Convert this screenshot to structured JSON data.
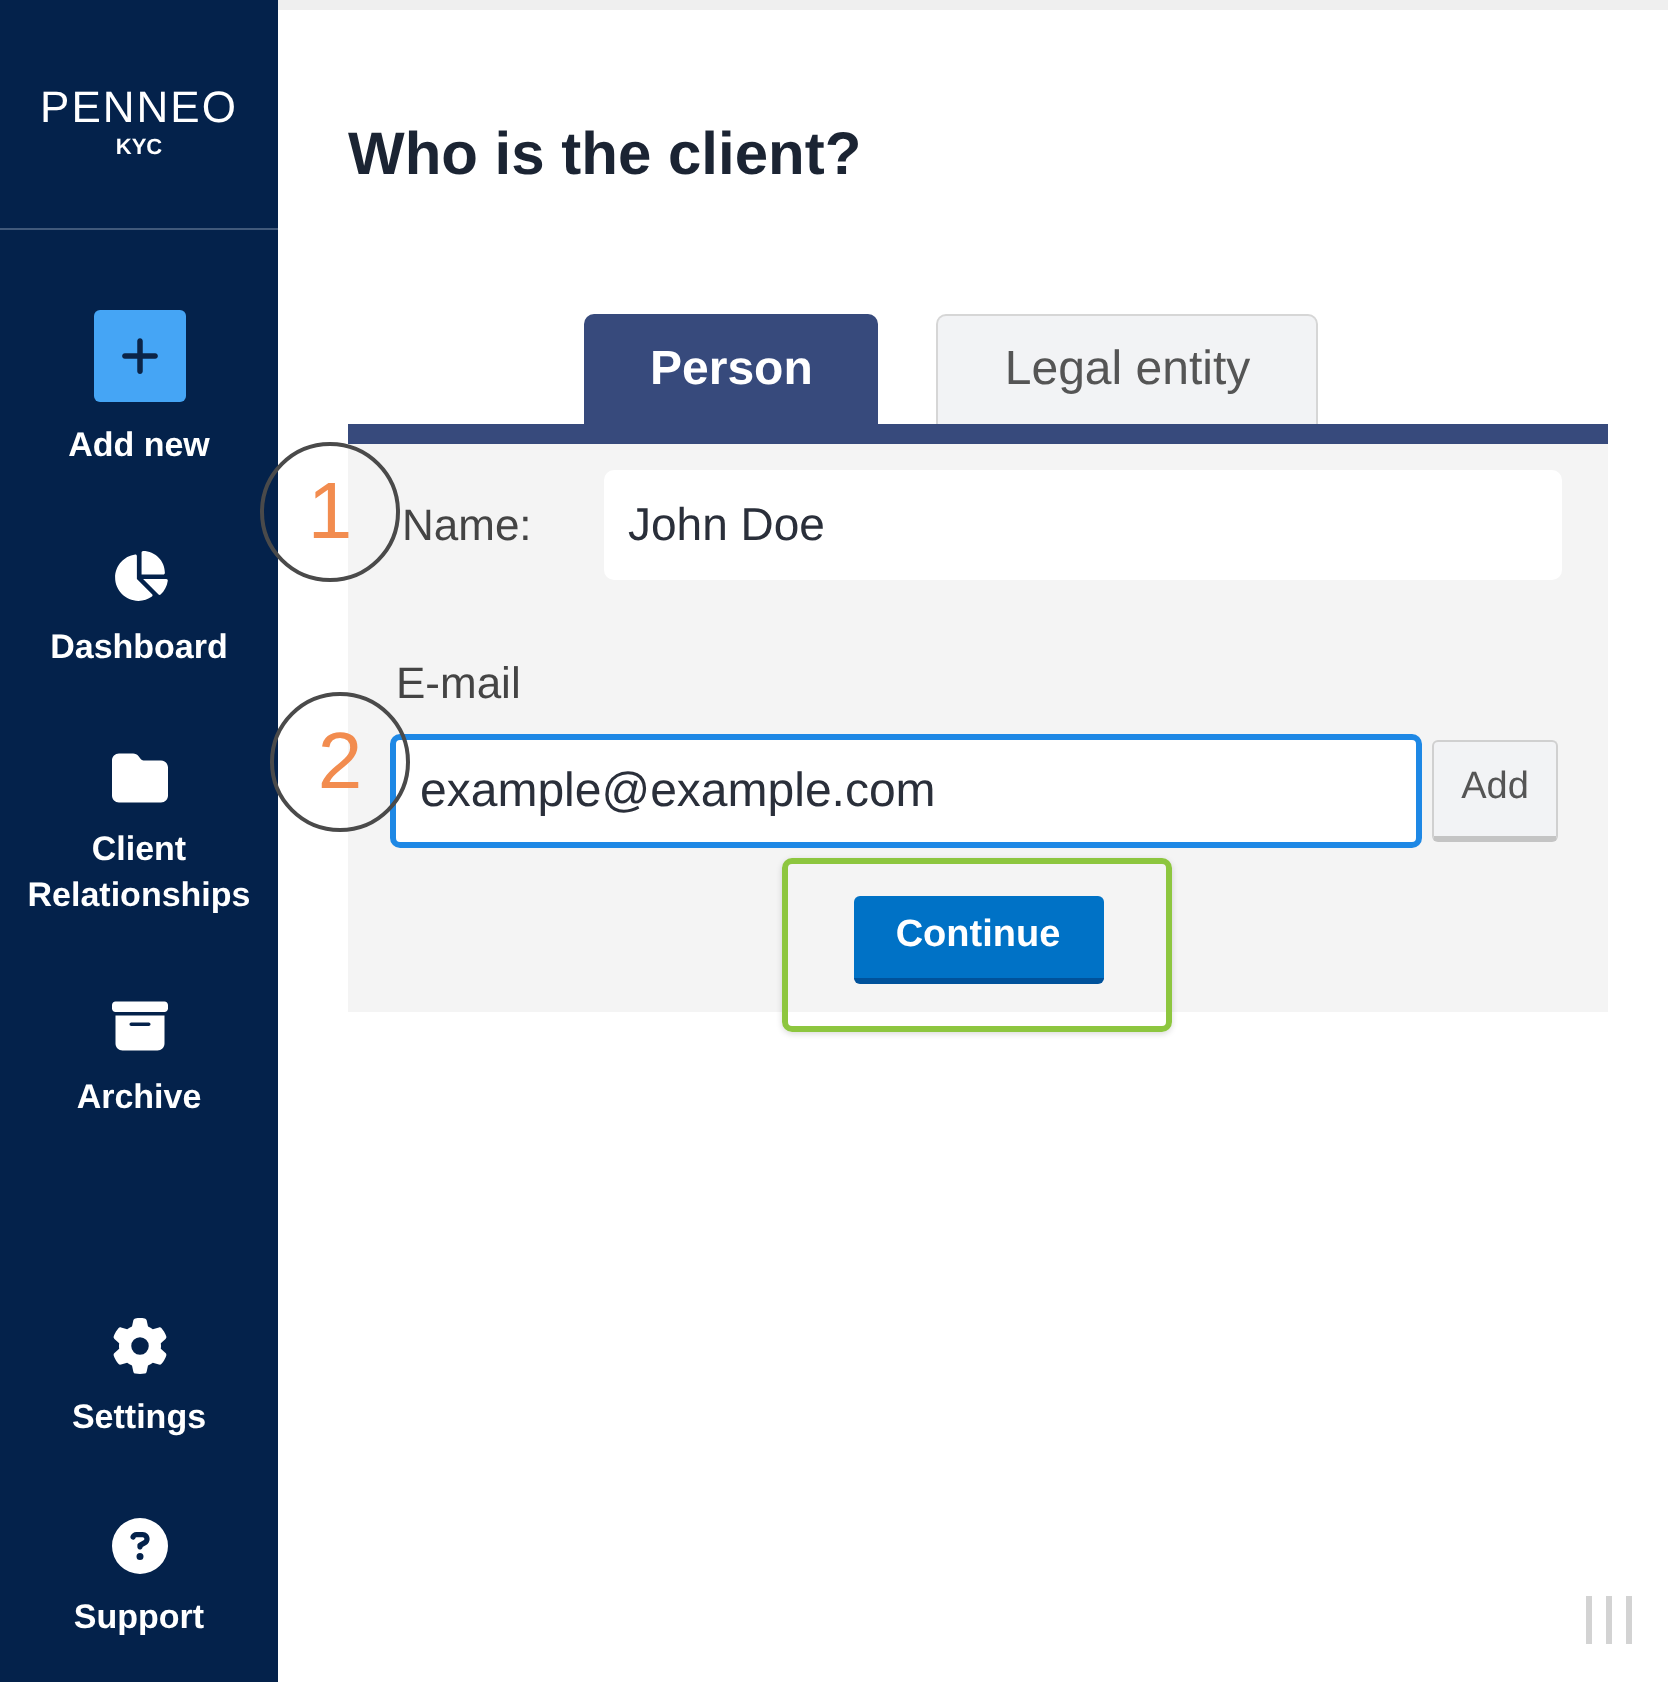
{
  "sidebar": {
    "logo": {
      "wordmark": "PENNEO",
      "product": "KYC"
    },
    "items": [
      {
        "kind": "add",
        "label": "Add new"
      },
      {
        "kind": "dashboard",
        "label": "Dashboard"
      },
      {
        "kind": "clients",
        "label": "Client Relationships"
      },
      {
        "kind": "archive",
        "label": "Archive"
      }
    ],
    "bottom_items": [
      {
        "kind": "settings",
        "label": "Settings"
      },
      {
        "kind": "support",
        "label": "Support"
      }
    ]
  },
  "page": {
    "title": "Who is the client?"
  },
  "tabs": [
    {
      "label": "Person",
      "selected": true
    },
    {
      "label": "Legal entity",
      "selected": false
    }
  ],
  "form": {
    "name": {
      "label": "Name:",
      "value": "John Doe"
    },
    "email": {
      "label": "E-mail",
      "value": "example@example.com",
      "focused": true
    },
    "add_button": {
      "label": "Add"
    },
    "continue_button": {
      "label": "Continue"
    }
  },
  "annotations": {
    "steps": [
      {
        "number": "1"
      },
      {
        "number": "2"
      }
    ]
  }
}
